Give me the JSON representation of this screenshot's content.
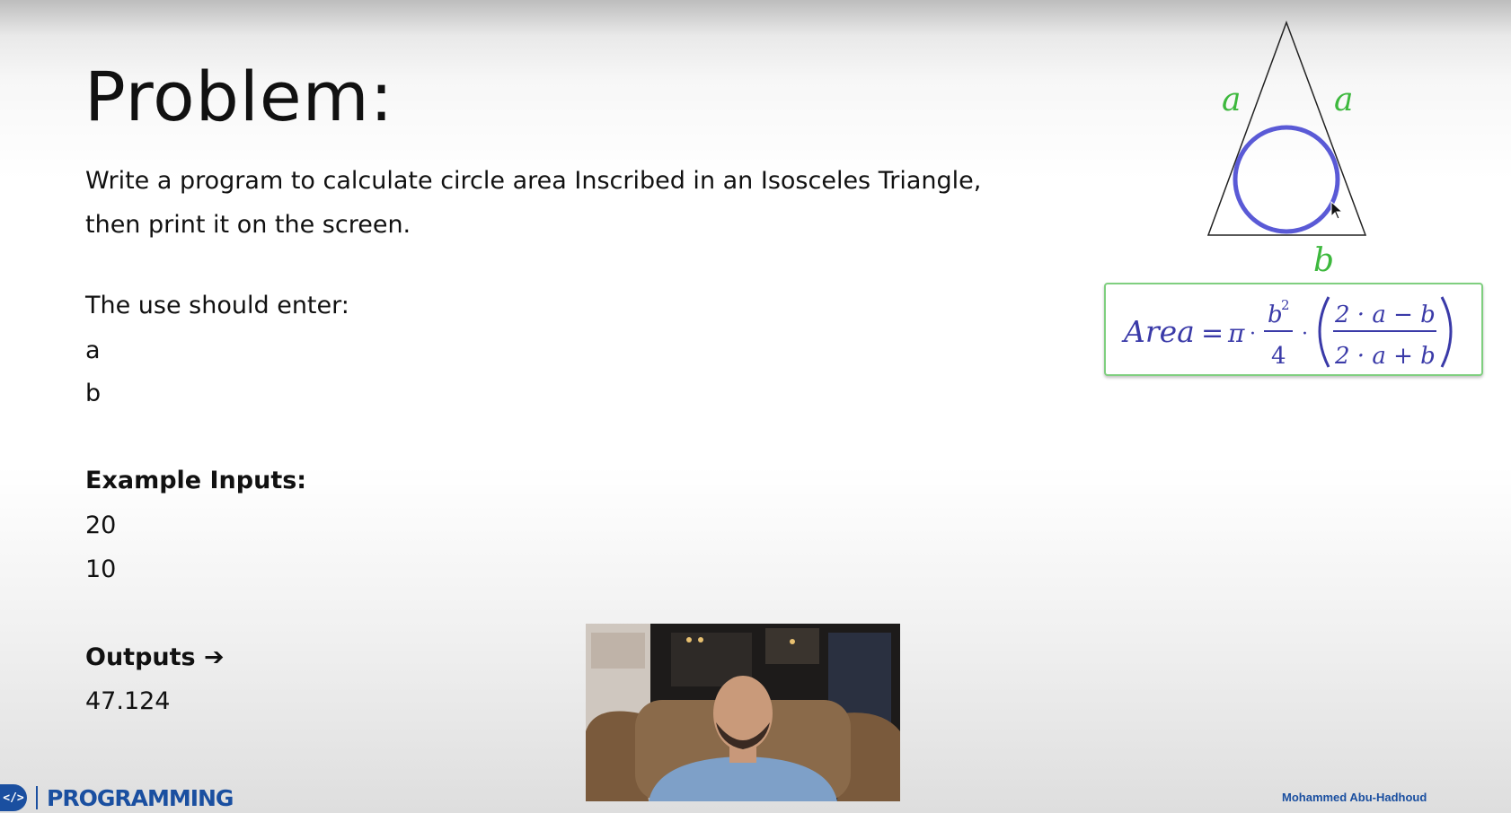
{
  "slide": {
    "title": "Problem:",
    "description_line1": "Write a program to calculate circle area Inscribed in an Isosceles Triangle,",
    "description_line2": "then print it on the screen.",
    "inputs_intro": "The use should enter:",
    "input_a": "a",
    "input_b": "b",
    "example_heading": "Example Inputs:",
    "example_1": "20",
    "example_2": "10",
    "outputs_heading": "Outputs ➔",
    "output_value": "47.124"
  },
  "diagram": {
    "side_left_label": "a",
    "side_right_label": "a",
    "base_label": "b",
    "label_color": "#3db83d",
    "circle_color": "#5a5ad6"
  },
  "formula": {
    "lhs": "Area",
    "eq": "=",
    "pi": "π",
    "dot": "·",
    "frac1_num": "b",
    "frac1_num_exp": "2",
    "frac1_den": "4",
    "frac2_num": "2 · a − b",
    "frac2_den": "2 · a + b",
    "color": "#3a3aa8"
  },
  "footer": {
    "logo_badge": "</>",
    "logo_text": "PROGRAMMING",
    "author": "Mohammed Abu-Hadhoud"
  }
}
